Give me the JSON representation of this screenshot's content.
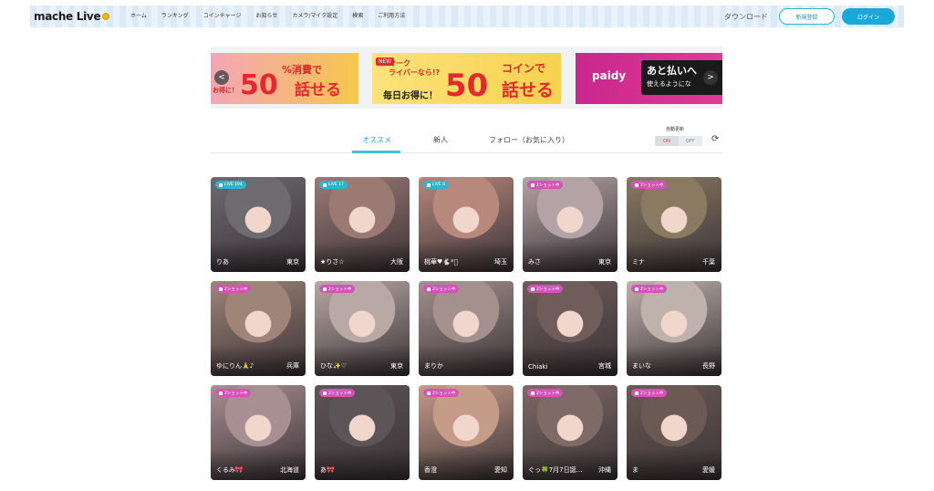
{
  "header": {
    "logo_text": "mache Live",
    "nav": [
      "ホーム",
      "ランキング",
      "コインチャージ",
      "お知らせ",
      "カメラ/マイク設定",
      "検索",
      "ご利用方法"
    ],
    "download_label": "ダウンロード",
    "register_label": "新規登録",
    "login_label": "ログイン"
  },
  "banners": {
    "b1": {
      "small": "%消費で",
      "tail": "お得に！",
      "big": "50",
      "big_suffix": "話せる"
    },
    "b2": {
      "tag": "NEW",
      "small1": "マーク",
      "small2": "ライバーなら!?",
      "small3": "毎日お得に！",
      "coin": "コインで",
      "big": "50",
      "big_suffix": "話せる"
    },
    "b3": {
      "brand": "paidy",
      "l1": "あと払いへ",
      "l2": "使えるようにな"
    },
    "prev_label": "<",
    "next_label": ">"
  },
  "tabs": {
    "items": [
      "オススメ",
      "新人",
      "フォロー（お気に入り）"
    ],
    "active": "オススメ",
    "auto_update_label": "自動更新",
    "on_label": "ON",
    "off_label": "OFF"
  },
  "cards": [
    {
      "name": "りあ",
      "pref": "東京",
      "badge": "LIVE 194",
      "type": "live",
      "bg": "#6d6a70"
    },
    {
      "name": "★りさ☆",
      "pref": "大阪",
      "badge": "LIVE 17",
      "type": "live",
      "bg": "#9b7a74"
    },
    {
      "name": "桃華♥🐇*゚",
      "pref": "埼玉",
      "badge": "LIVE 8",
      "type": "live",
      "bg": "#b7887c"
    },
    {
      "name": "みさ",
      "pref": "東京",
      "badge": "2ショット中",
      "type": "private",
      "bg": "#b3a3a6"
    },
    {
      "name": "ミナ",
      "pref": "千葉",
      "badge": "2ショット中",
      "type": "private",
      "bg": "#8a7a62"
    },
    {
      "name": "ゆにりん🙏♪",
      "pref": "兵庫",
      "badge": "2ショット中",
      "type": "private",
      "bg": "#9e8578"
    },
    {
      "name": "ひな✨♡",
      "pref": "東京",
      "badge": "2ショット中",
      "type": "private",
      "bg": "#b9a9a6"
    },
    {
      "name": "まりか",
      "pref": "",
      "badge": "2ショット中",
      "type": "private",
      "bg": "#a4918e"
    },
    {
      "name": "Chiaki",
      "pref": "宮城",
      "badge": "2ショット中",
      "type": "private",
      "bg": "#6f5c5b"
    },
    {
      "name": "まいな",
      "pref": "長野",
      "badge": "2ショット中",
      "type": "private",
      "bg": "#bfb2ac"
    },
    {
      "name": "くるみ🎀",
      "pref": "北海道",
      "badge": "2ショット中",
      "type": "private",
      "bg": "#a88f92"
    },
    {
      "name": "あ🎀",
      "pref": "",
      "badge": "2ショット中",
      "type": "private",
      "bg": "#5c5557"
    },
    {
      "name": "香澄",
      "pref": "愛知",
      "badge": "2ショット中",
      "type": "private",
      "bg": "#c59c88"
    },
    {
      "name": "ぐっ🍀7月7日誕…",
      "pref": "沖縄",
      "badge": "2ショット中",
      "type": "private",
      "bg": "#7e6a66"
    },
    {
      "name": "ま",
      "pref": "愛媛",
      "badge": "2ショット中",
      "type": "private",
      "bg": "#6b5a54"
    }
  ]
}
